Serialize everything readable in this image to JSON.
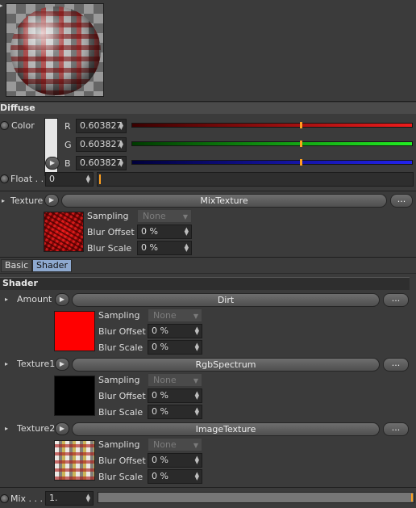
{
  "material": {
    "preview_icon": "material-sphere-preview"
  },
  "diffuse": {
    "section_title": "Diffuse",
    "color_label": "Color",
    "channels": [
      {
        "name": "R",
        "value": "0.603827",
        "color": "#c81414",
        "level": 0.6038
      },
      {
        "name": "G",
        "value": "0.603827",
        "color": "#1ec81e",
        "level": 0.6038
      },
      {
        "name": "B",
        "value": "0.603827",
        "color": "#1414c8",
        "level": 0.6038
      }
    ],
    "float_label": "Float . .",
    "float_value": "0",
    "texture_label": "Texture",
    "texture_name": "MixTexture",
    "more_label": "...",
    "sampling_label": "Sampling",
    "sampling_value": "None",
    "blur_offset_label": "Blur Offset",
    "blur_offset_value": "0 %",
    "blur_scale_label": "Blur Scale",
    "blur_scale_value": "0 %"
  },
  "tabs": [
    {
      "label": "Basic",
      "active": false
    },
    {
      "label": "Shader",
      "active": true
    }
  ],
  "shader": {
    "section_title": "Shader",
    "rows": [
      {
        "label": "Amount",
        "texture_name": "Dirt",
        "thumb_color": "#ff0000",
        "sampling_label": "Sampling",
        "sampling_value": "None",
        "blur_offset_label": "Blur Offset",
        "blur_offset_value": "0 %",
        "blur_scale_label": "Blur Scale",
        "blur_scale_value": "0 %",
        "more_label": "..."
      },
      {
        "label": "Texture1",
        "texture_name": "RgbSpectrum",
        "thumb_color": "#000000",
        "sampling_label": "Sampling",
        "sampling_value": "None",
        "blur_offset_label": "Blur Offset",
        "blur_offset_value": "0 %",
        "blur_scale_label": "Blur Scale",
        "blur_scale_value": "0 %",
        "more_label": "..."
      },
      {
        "label": "Texture2",
        "texture_name": "ImageTexture",
        "thumb_color": "#c8c0b0",
        "sampling_label": "Sampling",
        "sampling_value": "None",
        "blur_offset_label": "Blur Offset",
        "blur_offset_value": "0 %",
        "blur_scale_label": "Blur Scale",
        "blur_scale_value": "0 %",
        "more_label": "..."
      }
    ],
    "mix_label": "Mix . . .",
    "mix_value": "1."
  },
  "colors": {
    "slider_knob": "#ffa020",
    "active_tab": "#8ea9cf"
  }
}
